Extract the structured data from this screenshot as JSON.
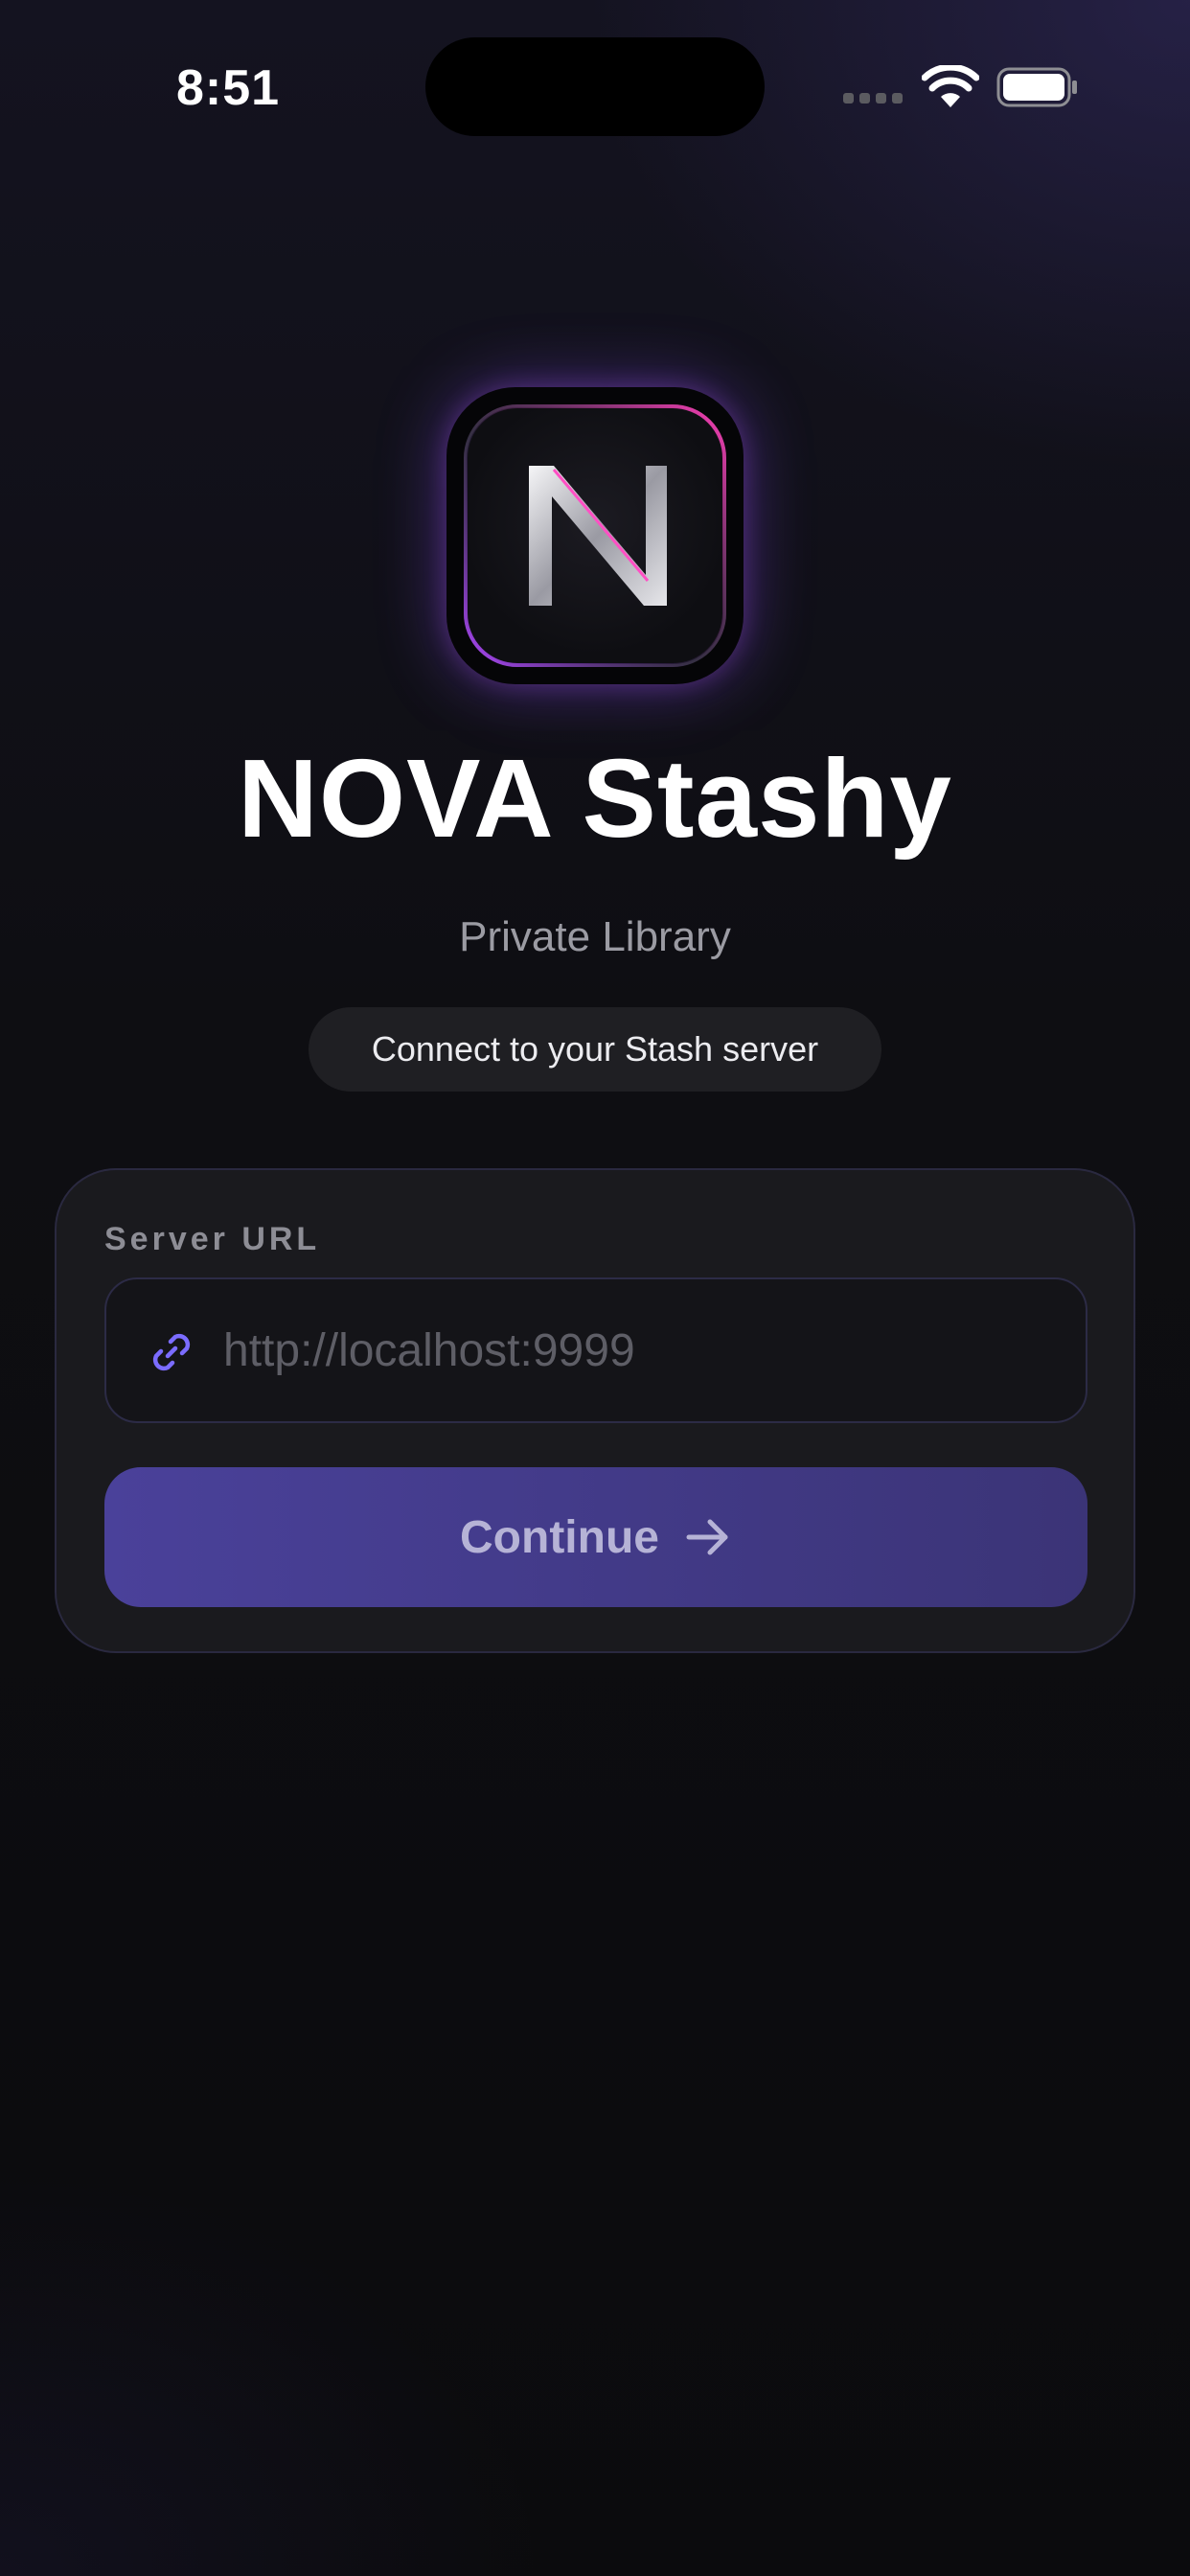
{
  "status_bar": {
    "time": "8:51"
  },
  "app": {
    "logo_letter": "N",
    "title": "NOVA Stashy",
    "subtitle": "Private Library",
    "tagline": "Connect to your Stash server"
  },
  "form": {
    "server_url_label": "Server URL",
    "server_url_value": "",
    "server_url_placeholder": "http://localhost:9999",
    "continue_label": "Continue"
  },
  "icons": {
    "status": [
      "cellular-signal-icon",
      "wifi-icon",
      "battery-icon"
    ],
    "field": "link-icon",
    "button": "arrow-right-icon"
  },
  "colors": {
    "accent": "#4a419a",
    "accent_icon": "#7b6cff",
    "background": "#0e0e12",
    "card": "#1a1a1e"
  }
}
